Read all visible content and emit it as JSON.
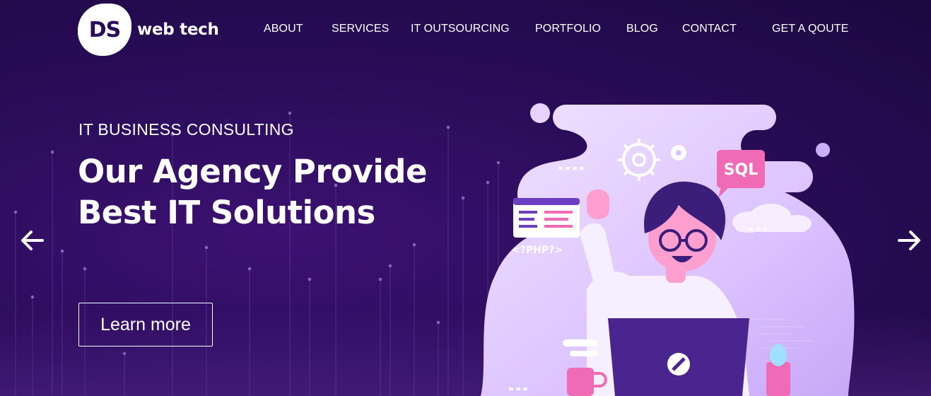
{
  "brand": {
    "logo_mark": "DS",
    "name": "web tech"
  },
  "nav": {
    "items": [
      {
        "label": "ABOUT"
      },
      {
        "label": "SERVICES"
      },
      {
        "label": "IT OUTSOURCING"
      },
      {
        "label": "PORTFOLIO"
      },
      {
        "label": "BLOG"
      },
      {
        "label": "CONTACT"
      },
      {
        "label": "GET A QOUTE"
      }
    ]
  },
  "hero": {
    "eyebrow": "IT BUSINESS CONSULTING",
    "headline_line1": "Our Agency Provide",
    "headline_line2": "Best IT Solutions",
    "cta_label": "Learn more"
  },
  "illustration": {
    "sql_badge": "SQL",
    "php_tag": "<?PHP?>"
  },
  "controls": {
    "prev_icon": "arrow-left-icon",
    "next_icon": "arrow-right-icon"
  },
  "colors": {
    "background": "#2a0d5a",
    "blob": "#e7d3ff",
    "accent_pink": "#f06bb6",
    "character_hair": "#3b1d7a",
    "laptop": "#4a2590"
  }
}
